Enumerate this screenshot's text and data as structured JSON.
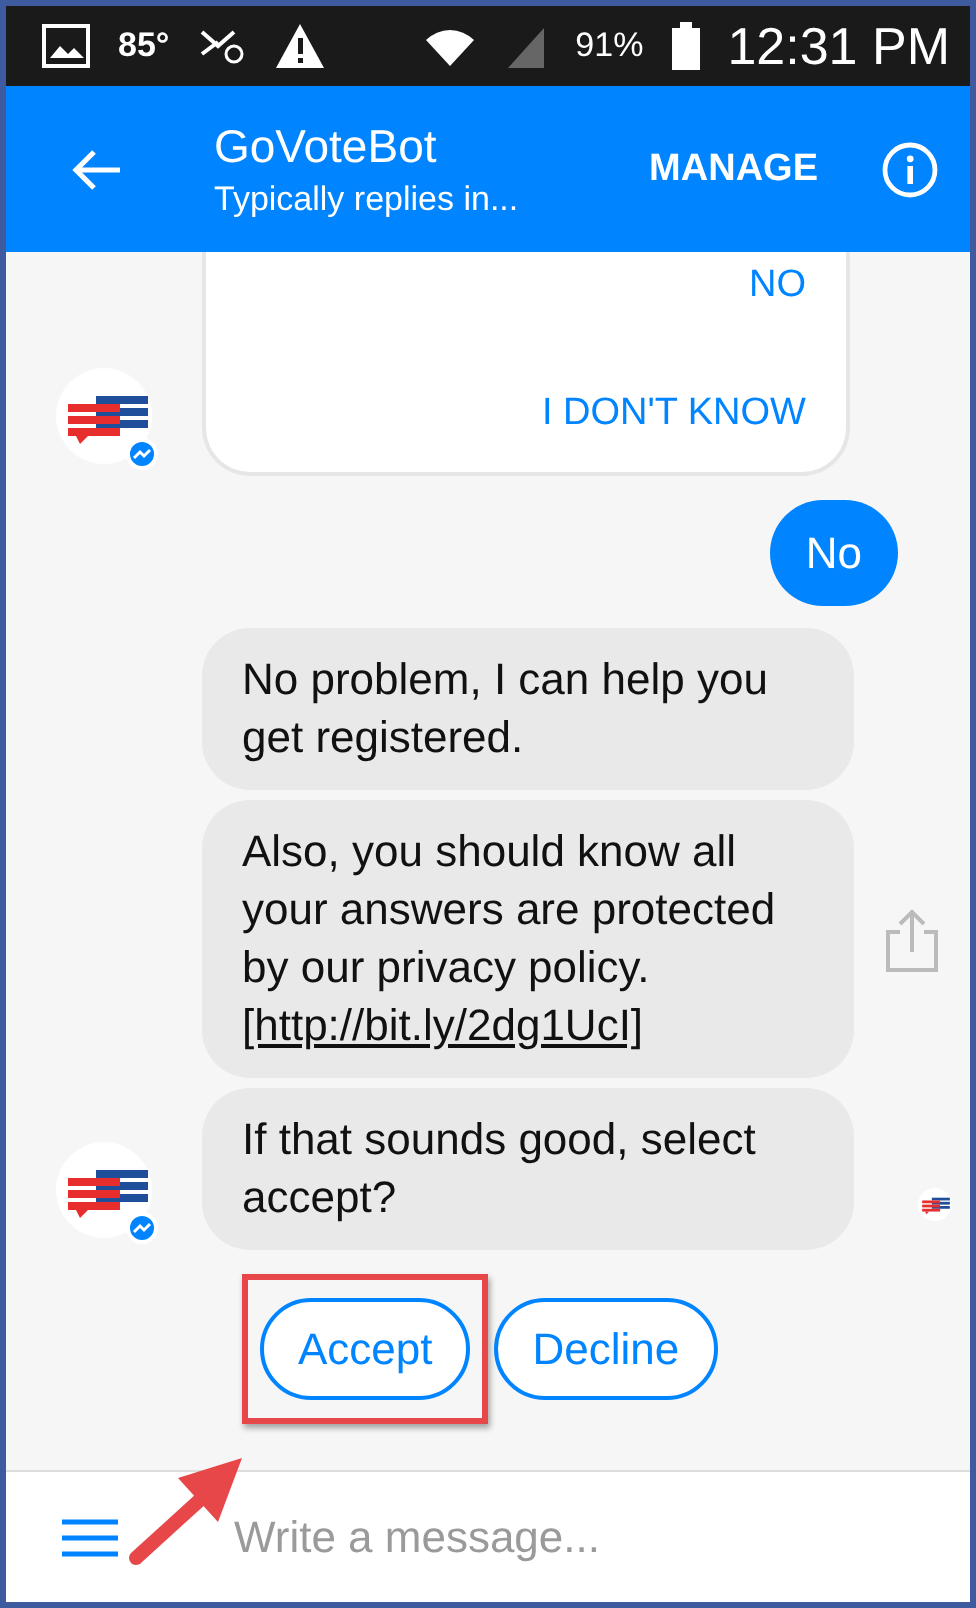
{
  "status_bar": {
    "temperature": "85°",
    "battery": "91%",
    "time": "12:31 PM"
  },
  "header": {
    "title": "GoVoteBot",
    "subtitle": "Typically replies in...",
    "action": "MANAGE"
  },
  "option_card": {
    "options": [
      "NO",
      "I DON'T KNOW"
    ]
  },
  "outgoing": {
    "text": "No"
  },
  "bot_messages": [
    {
      "text": "No problem, I can help you get registered.",
      "shareable": false,
      "seen": false
    },
    {
      "text": "Also, you should know all your answers are protected by our privacy policy.",
      "link": "[http://bit.ly/2dg1UcI]",
      "shareable": true,
      "seen": false
    },
    {
      "text": "If that sounds good, select accept?",
      "shareable": false,
      "seen": true
    }
  ],
  "quick_replies": [
    {
      "label": "Accept",
      "highlighted": true
    },
    {
      "label": "Decline",
      "highlighted": false
    }
  ],
  "composer": {
    "placeholder": "Write a message..."
  }
}
